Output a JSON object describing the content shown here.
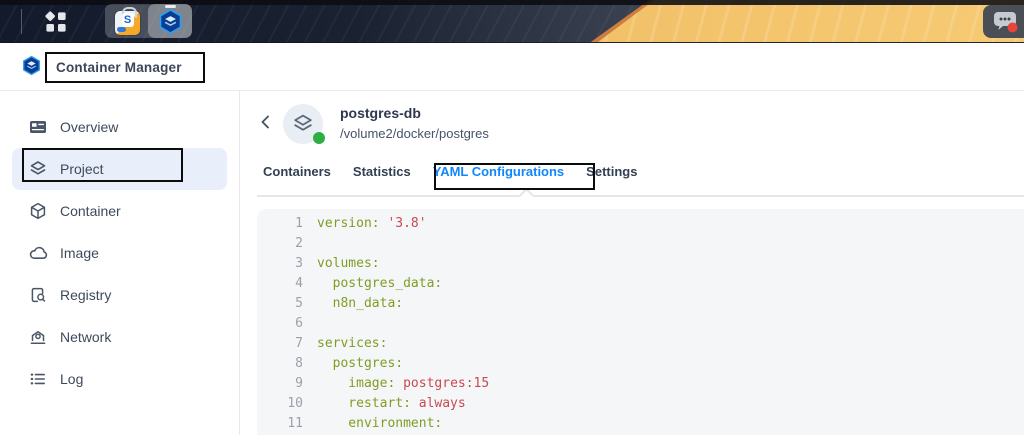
{
  "window": {
    "title": "Container Manager"
  },
  "taskbar": {
    "package_center_letter": "S",
    "icons": [
      "main-menu-grid-icon",
      "package-center-icon",
      "container-manager-icon",
      "chat-bubble-icon"
    ],
    "notification_dot_color": "#e8443a"
  },
  "sidebar": {
    "items": [
      {
        "label": "Overview",
        "icon": "overview-card-icon"
      },
      {
        "label": "Project",
        "icon": "layers-icon",
        "selected": true
      },
      {
        "label": "Container",
        "icon": "cube-icon"
      },
      {
        "label": "Image",
        "icon": "cloud-icon"
      },
      {
        "label": "Registry",
        "icon": "document-search-icon"
      },
      {
        "label": "Network",
        "icon": "network-hub-icon"
      },
      {
        "label": "Log",
        "icon": "list-icon"
      }
    ]
  },
  "project_header": {
    "name": "postgres-db",
    "path": "/volume2/docker/postgres",
    "status_color": "#2fae44"
  },
  "tabs": [
    {
      "label": "Containers",
      "active": false
    },
    {
      "label": "Statistics",
      "active": false
    },
    {
      "label": "YAML Configurations",
      "active": true
    },
    {
      "label": "Settings",
      "active": false
    }
  ],
  "code": {
    "language": "yaml",
    "lines": [
      {
        "num": "1",
        "key": "version:",
        "value": " '3.8'"
      },
      {
        "num": "2",
        "key": "",
        "value": ""
      },
      {
        "num": "3",
        "key": "volumes:",
        "value": ""
      },
      {
        "num": "4",
        "key": "  postgres_data:",
        "value": ""
      },
      {
        "num": "5",
        "key": "  n8n_data:",
        "value": ""
      },
      {
        "num": "6",
        "key": "",
        "value": ""
      },
      {
        "num": "7",
        "key": "services:",
        "value": ""
      },
      {
        "num": "8",
        "key": "  postgres:",
        "value": ""
      },
      {
        "num": "9",
        "key": "    image:",
        "value": " postgres:15"
      },
      {
        "num": "10",
        "key": "    restart:",
        "value": " always"
      },
      {
        "num": "11",
        "key": "    environment:",
        "value": ""
      }
    ]
  },
  "colors": {
    "accent_blue": "#1086fb",
    "yaml_key_green": "#7f9d23",
    "yaml_value_red": "#c84a50",
    "status_green": "#2fae44",
    "wallpaper_sand": "#f0bd63",
    "wallpaper_navy": "#1a2232",
    "annotation_black": "#0c0c0c"
  }
}
